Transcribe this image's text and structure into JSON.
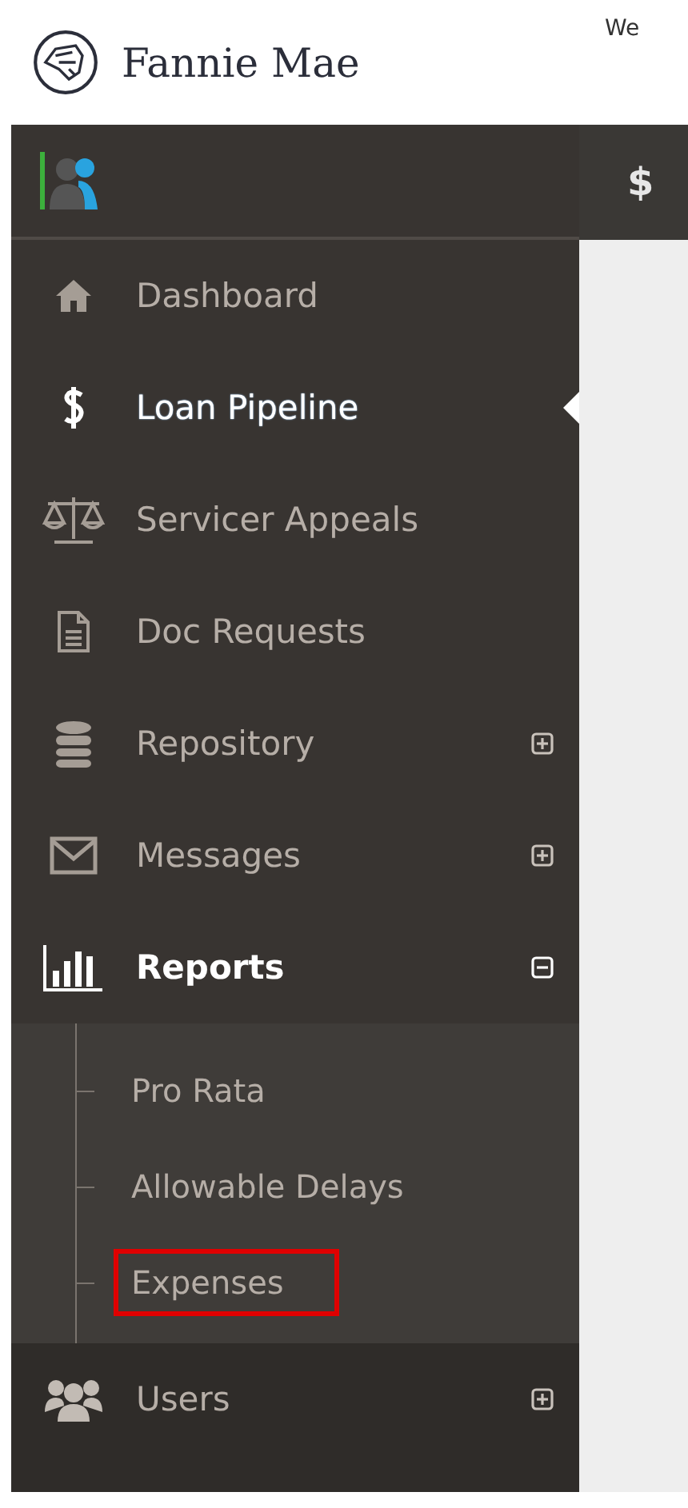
{
  "header": {
    "logo_text": "Fannie Mae",
    "welcome": "We"
  },
  "content_header": {
    "title_fragment": "$"
  },
  "sidebar": {
    "items": [
      {
        "label": "Dashboard",
        "kind": "link",
        "selected": false
      },
      {
        "label": "Loan Pipeline",
        "kind": "link",
        "selected": true
      },
      {
        "label": "Servicer Appeals",
        "kind": "link",
        "selected": false
      },
      {
        "label": "Doc Requests",
        "kind": "link",
        "selected": false
      },
      {
        "label": "Repository",
        "kind": "group",
        "selected": false,
        "expanded": false
      },
      {
        "label": "Messages",
        "kind": "group",
        "selected": false,
        "expanded": false
      },
      {
        "label": "Reports",
        "kind": "group",
        "selected": false,
        "expanded": true,
        "children": [
          {
            "label": "Pro Rata",
            "highlighted": false
          },
          {
            "label": "Allowable Delays",
            "highlighted": false
          },
          {
            "label": "Expenses",
            "highlighted": true
          }
        ]
      },
      {
        "label": "Users",
        "kind": "group",
        "selected": false,
        "expanded": false
      }
    ]
  }
}
